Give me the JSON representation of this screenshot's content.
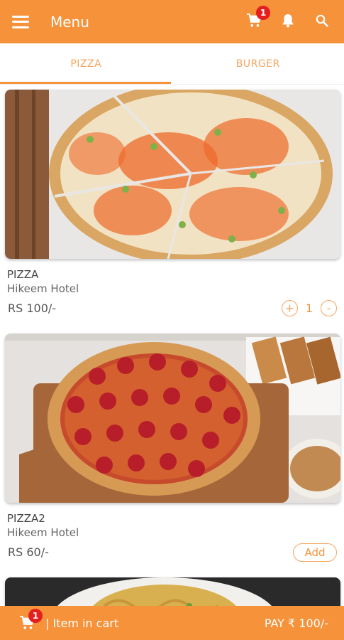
{
  "header": {
    "title": "Menu",
    "cart_badge": "1",
    "icons": [
      "menu-icon",
      "cart-icon",
      "bell-icon",
      "search-icon"
    ]
  },
  "tabs": [
    {
      "label": "PIZZA",
      "active": true
    },
    {
      "label": "BURGER",
      "active": false
    }
  ],
  "items": [
    {
      "name": "PIZZA",
      "hotel": "Hikeem Hotel",
      "price": "RS 100/-",
      "quantity": "1",
      "minus": "-",
      "plus": "+"
    },
    {
      "name": "PIZZA2",
      "hotel": "Hikeem Hotel",
      "price": "RS 60/-",
      "add_label": "Add"
    }
  ],
  "footer": {
    "cart_badge": "1",
    "cart_text": "| Item in cart",
    "pay_text": "PAY ₹ 100/-"
  },
  "colors": {
    "primary": "#f5923a",
    "badge": "#e51e1e"
  }
}
